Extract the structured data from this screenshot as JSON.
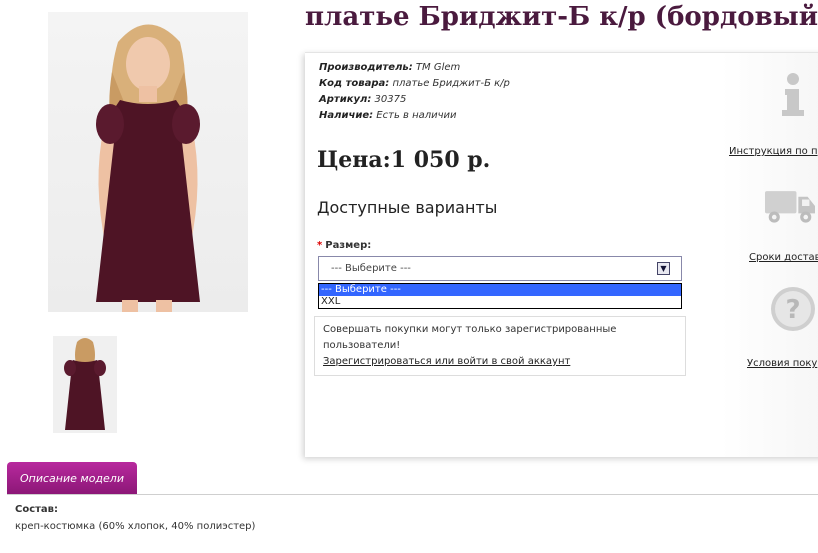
{
  "product": {
    "title": "платье Бриджит-Б к/р (бордовый)",
    "manufacturer_label": "Производитель:",
    "manufacturer_value": "TM Glem",
    "code_label": "Код товара:",
    "code_value": "платье Бриджит-Б к/р",
    "article_label": "Артикул:",
    "article_value": "30375",
    "availability_label": "Наличие:",
    "availability_value": "Есть в наличии",
    "price": "Цена:1 050 р."
  },
  "options": {
    "heading": "Доступные варианты",
    "size_label": "Размер:",
    "required_mark": "*",
    "select_value": "--- Выберите ---",
    "dropdown": [
      "--- Выберите ---",
      "XXL"
    ]
  },
  "notice": {
    "text": "Совершать покупки могут только зарегистрированные пользователи!",
    "link": "Зарегистрироваться или войти в свой аккаунт"
  },
  "side": [
    {
      "icon": "info-icon",
      "label": "Инструкция по п"
    },
    {
      "icon": "truck-icon",
      "label": "Сроки достав"
    },
    {
      "icon": "question-icon",
      "label": "Условия поку"
    }
  ],
  "description": {
    "tab": "Описание модели",
    "heading": "Состав:",
    "text": "креп-костюмка (60% хлопок, 40% полиэстер)"
  },
  "colors": {
    "dress": "#4e1425",
    "title": "#4a1a3e",
    "tab": "#a02188",
    "select_highlight": "#3366ff"
  }
}
